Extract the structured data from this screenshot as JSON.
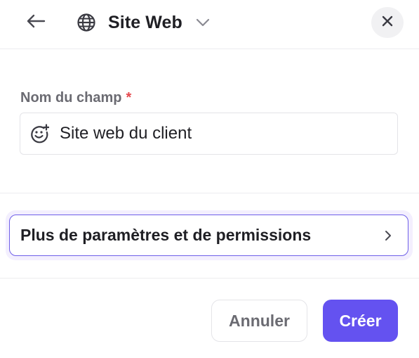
{
  "header": {
    "back_icon": "arrow-left-icon",
    "field_type": {
      "icon": "globe-icon",
      "label": "Site Web",
      "dropdown_icon": "chevron-down-icon"
    },
    "close_icon": "close-icon"
  },
  "field": {
    "label": "Nom du champ",
    "required_marker": "*",
    "emoji_icon": "emoji-add-icon",
    "value": "Site web du client"
  },
  "more_settings": {
    "label": "Plus de paramètres et de permissions",
    "icon": "chevron-right-icon"
  },
  "footer": {
    "cancel_label": "Annuler",
    "create_label": "Créer"
  },
  "colors": {
    "accent": "#6452f0",
    "accent_border": "#6f5fe8",
    "focus_ring": "#f3effe",
    "required": "#e5484d",
    "muted_text": "#6b6b72",
    "divider": "#ececef"
  }
}
